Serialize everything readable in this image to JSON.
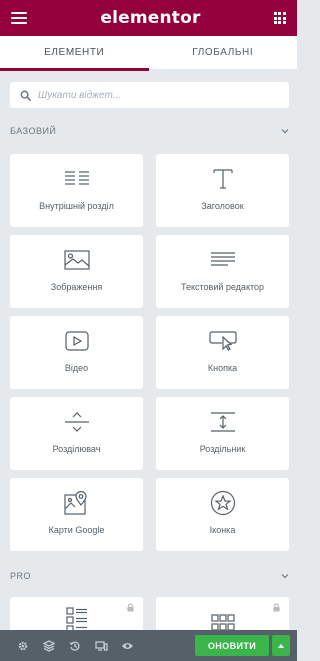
{
  "header": {
    "logo_text": "elementor",
    "brand_color": "#93003c"
  },
  "tabs": [
    {
      "label": "ЕЛЕМЕНТИ",
      "active": true
    },
    {
      "label": "ГЛОБАЛЬНІ",
      "active": false
    }
  ],
  "search": {
    "placeholder": "Шукати віджет..."
  },
  "sections": {
    "basic": {
      "title": "БАЗОВИЙ",
      "expanded": true
    },
    "pro": {
      "title": "PRO",
      "expanded": true
    }
  },
  "widgets": [
    {
      "label": "Внутрішній розділ",
      "icon": "inner-section-icon"
    },
    {
      "label": "Заголовок",
      "icon": "heading-icon"
    },
    {
      "label": "Зображення",
      "icon": "image-icon"
    },
    {
      "label": "Текстовий редактор",
      "icon": "text-editor-icon"
    },
    {
      "label": "Відео",
      "icon": "video-icon"
    },
    {
      "label": "Кнопка",
      "icon": "button-icon"
    },
    {
      "label": "Розділювач",
      "icon": "divider-icon"
    },
    {
      "label": "Роздільник",
      "icon": "spacer-icon"
    },
    {
      "label": "Карти Google",
      "icon": "google-maps-icon"
    },
    {
      "label": "Іконка",
      "icon": "star-icon"
    }
  ],
  "pro_widgets": [
    {
      "icon": "posts-icon",
      "locked": true
    },
    {
      "icon": "portfolio-icon",
      "locked": true
    }
  ],
  "footer": {
    "update_label": "ОНОВИТИ",
    "update_color": "#39b54a",
    "icons": [
      "settings-icon",
      "navigator-icon",
      "history-icon",
      "responsive-icon",
      "preview-icon"
    ]
  }
}
